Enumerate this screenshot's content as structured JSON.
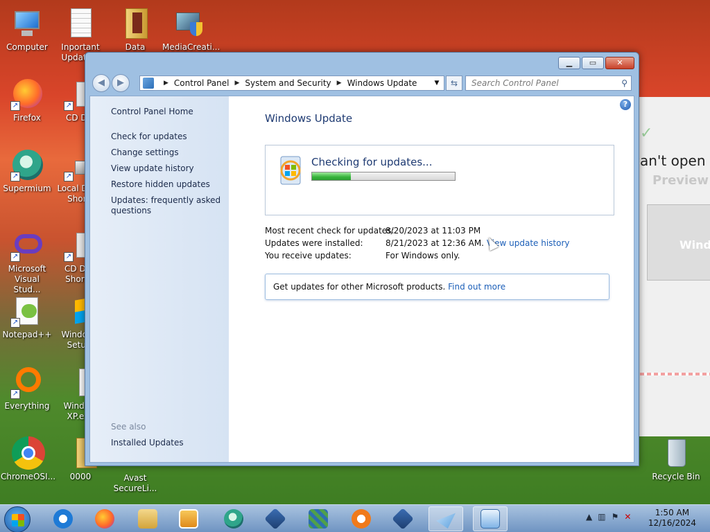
{
  "desktop": {
    "icons": [
      {
        "label": "Computer"
      },
      {
        "label": "Inportant Update..."
      },
      {
        "label": "Data"
      },
      {
        "label": "MediaCreati..."
      },
      {
        "label": "Firefox"
      },
      {
        "label": "CD D..."
      },
      {
        "label": "Supermium"
      },
      {
        "label": "Local Di... - Shor..."
      },
      {
        "label": "Microsoft Visual Stud..."
      },
      {
        "label": "CD Dr... Short..."
      },
      {
        "label": "Notepad++"
      },
      {
        "label": "Windov... Setu..."
      },
      {
        "label": "Everything"
      },
      {
        "label": "Windo... XP.exe"
      },
      {
        "label": "ChromeOSI..."
      },
      {
        "label": "0000"
      },
      {
        "label": "Avast SecureLi..."
      },
      {
        "label": "Recycle Bin"
      }
    ],
    "background_window": {
      "text1": "an't open m",
      "text2": "Preview",
      "text3": "Wind"
    }
  },
  "window": {
    "caption_buttons": {
      "minimize": "▁",
      "maximize": "▭",
      "close": "✕"
    },
    "breadcrumb": [
      "Control Panel",
      "System and Security",
      "Windows Update"
    ],
    "search_placeholder": "Search Control Panel",
    "sidebar": {
      "home": "Control Panel Home",
      "links": [
        "Check for updates",
        "Change settings",
        "View update history",
        "Restore hidden updates",
        "Updates: frequently asked questions"
      ],
      "see_also": "See also",
      "installed_updates": "Installed Updates"
    },
    "main": {
      "title": "Windows Update",
      "status": "Checking for updates...",
      "progress": 0.27,
      "info": [
        {
          "label": "Most recent check for updates:",
          "value": "8/20/2023 at 11:03 PM"
        },
        {
          "label": "Updates were installed:",
          "value": "8/21/2023 at 12:36 AM.",
          "link": "View update history"
        },
        {
          "label": "You receive updates:",
          "value": "For Windows only."
        }
      ],
      "promo_text": "Get updates for other Microsoft products.",
      "promo_link": "Find out more"
    }
  },
  "taskbar": {
    "clock_time": "1:50 AM",
    "clock_date": "12/16/2024"
  },
  "colors": {
    "accent": "#1e3a72",
    "link": "#1c5fb8",
    "progress": "#35b33a"
  }
}
